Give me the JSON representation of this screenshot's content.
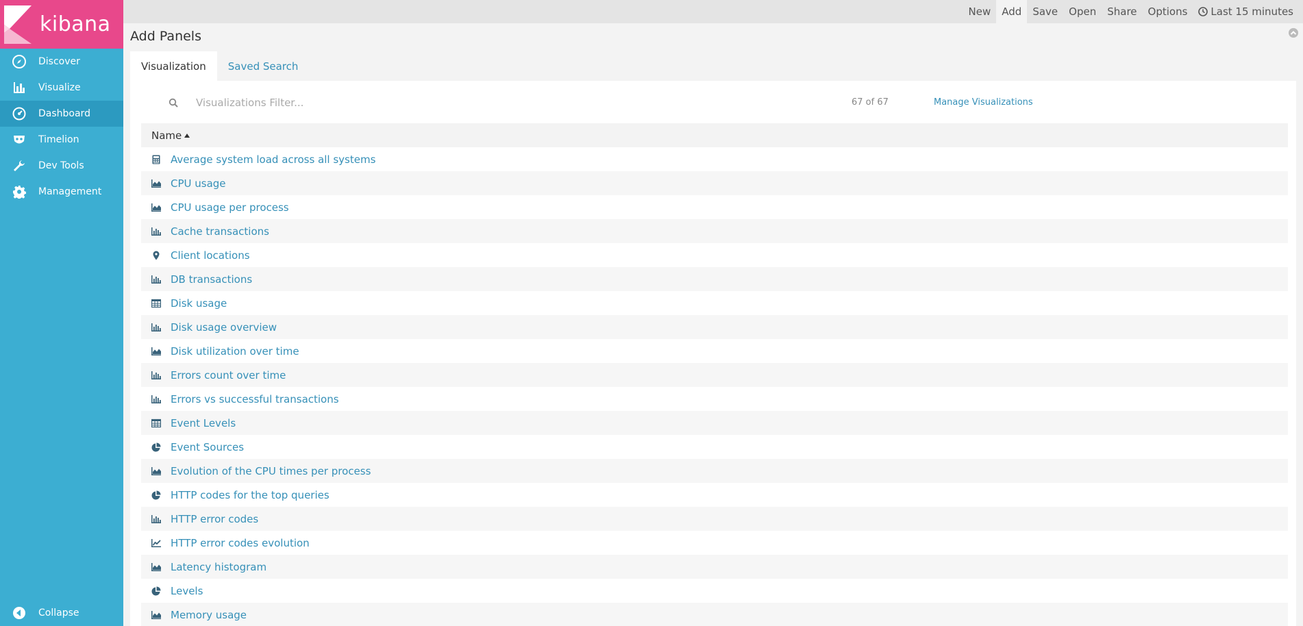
{
  "brand": {
    "name": "kibana"
  },
  "sidebar": {
    "items": [
      {
        "label": "Discover",
        "icon": "compass-icon"
      },
      {
        "label": "Visualize",
        "icon": "bar-chart-icon"
      },
      {
        "label": "Dashboard",
        "icon": "dashboard-gauge-icon",
        "active": true
      },
      {
        "label": "Timelion",
        "icon": "timelion-mask-icon"
      },
      {
        "label": "Dev Tools",
        "icon": "wrench-icon"
      },
      {
        "label": "Management",
        "icon": "gear-icon"
      }
    ],
    "collapse_label": "Collapse"
  },
  "topbar": {
    "buttons": [
      "New",
      "Add",
      "Save",
      "Open",
      "Share",
      "Options"
    ],
    "active": "Add",
    "time_range": "Last 15 minutes"
  },
  "main": {
    "title": "Add Panels",
    "tabs": [
      {
        "label": "Visualization",
        "active": true
      },
      {
        "label": "Saved Search",
        "active": false
      }
    ],
    "filter": {
      "placeholder": "Visualizations Filter...",
      "value": ""
    },
    "count": "67 of 67",
    "manage_link": "Manage Visualizations",
    "column_header": "Name",
    "rows": [
      {
        "icon": "metric-calculator-icon",
        "label": "Average system load across all systems"
      },
      {
        "icon": "area-chart-icon",
        "label": "CPU usage"
      },
      {
        "icon": "area-chart-icon",
        "label": "CPU usage per process"
      },
      {
        "icon": "bar-chart-icon",
        "label": "Cache transactions"
      },
      {
        "icon": "map-marker-icon",
        "label": "Client locations"
      },
      {
        "icon": "bar-chart-icon",
        "label": "DB transactions"
      },
      {
        "icon": "table-icon",
        "label": "Disk usage"
      },
      {
        "icon": "bar-chart-icon",
        "label": "Disk usage overview"
      },
      {
        "icon": "area-chart-icon",
        "label": "Disk utilization over time"
      },
      {
        "icon": "bar-chart-icon",
        "label": "Errors count over time"
      },
      {
        "icon": "bar-chart-icon",
        "label": "Errors vs successful transactions"
      },
      {
        "icon": "table-icon",
        "label": "Event Levels"
      },
      {
        "icon": "pie-chart-icon",
        "label": "Event Sources"
      },
      {
        "icon": "area-chart-icon",
        "label": "Evolution of the CPU times per process"
      },
      {
        "icon": "pie-chart-icon",
        "label": "HTTP codes for the top queries"
      },
      {
        "icon": "bar-chart-icon",
        "label": "HTTP error codes"
      },
      {
        "icon": "line-chart-icon",
        "label": "HTTP error codes evolution"
      },
      {
        "icon": "area-chart-icon",
        "label": "Latency histogram"
      },
      {
        "icon": "pie-chart-icon",
        "label": "Levels"
      },
      {
        "icon": "area-chart-icon",
        "label": "Memory usage"
      }
    ]
  },
  "colors": {
    "sidebar": "#3caed2",
    "sidebar_active": "#2c9ac0",
    "logo_bg": "#e8488b",
    "link": "#3690b8",
    "icon": "#38627a"
  }
}
